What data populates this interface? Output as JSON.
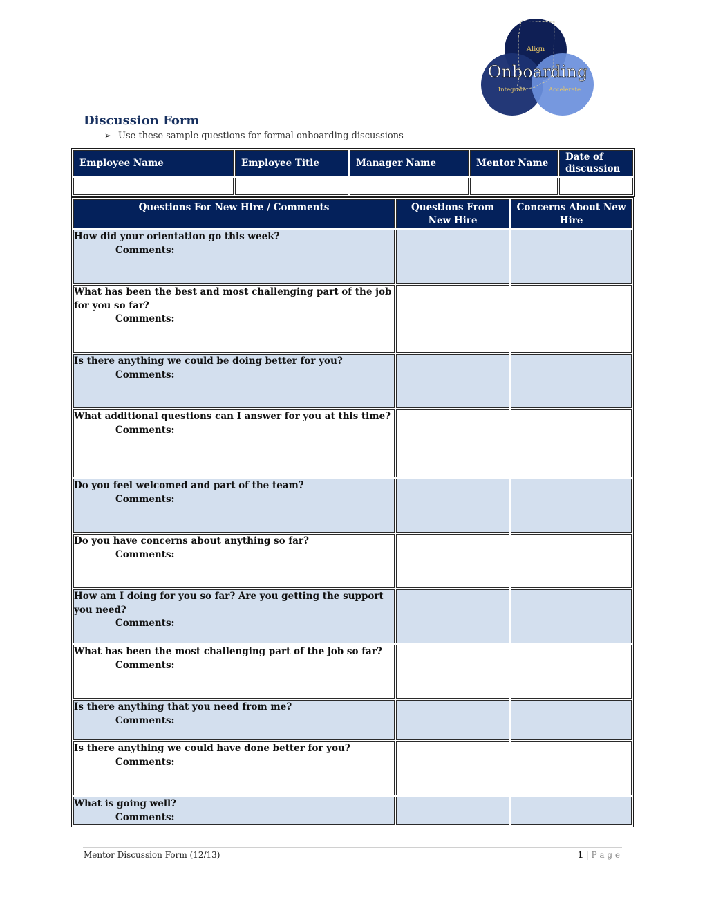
{
  "logo": {
    "brand_text": "Onboarding",
    "circle_labels": [
      "Align",
      "Integrate",
      "Accelerate"
    ],
    "colors": {
      "align": "#0f1f55",
      "integrate": "#1c3273",
      "accelerate": "#6a8fdc",
      "label_gold": "#e8c766"
    }
  },
  "header": {
    "title": "Discussion Form",
    "bullet_icon": "arrowhead-bullet",
    "subtitle": "Use these sample questions for formal onboarding discussions"
  },
  "info_table": {
    "columns": [
      "Employee Name",
      "Employee Title",
      "Manager Name",
      "Mentor Name",
      "Date of discussion"
    ],
    "values": [
      "",
      "",
      "",
      "",
      ""
    ]
  },
  "questions_table": {
    "columns": [
      "Questions For New Hire / Comments",
      "Questions From New Hire",
      "Concerns About New Hire"
    ],
    "comments_label": "Comments:",
    "rows": [
      {
        "question": "How did your orientation go this week?",
        "questions_from": "",
        "concerns": ""
      },
      {
        "question": "What has been the best and most challenging part of the job for you so far?",
        "questions_from": "",
        "concerns": ""
      },
      {
        "question": "Is there anything we could be doing better for you?",
        "questions_from": "",
        "concerns": ""
      },
      {
        "question": "What additional questions can I answer for you at this time?",
        "questions_from": "",
        "concerns": ""
      },
      {
        "question": "Do you feel welcomed and part of the team?",
        "questions_from": "",
        "concerns": ""
      },
      {
        "question": "Do you have concerns about anything so far?",
        "questions_from": "",
        "concerns": ""
      },
      {
        "question": "How am I doing for you so far? Are you getting the support you need?",
        "questions_from": "",
        "concerns": ""
      },
      {
        "question": "What has been the most challenging part of the job so far?",
        "questions_from": "",
        "concerns": ""
      },
      {
        "question": "Is there anything that you need from me?",
        "questions_from": "",
        "concerns": ""
      },
      {
        "question": "Is there anything we could have done better for you?",
        "questions_from": "",
        "concerns": ""
      },
      {
        "question": "What is going well?",
        "questions_from": "",
        "concerns": ""
      }
    ]
  },
  "colors": {
    "header_fill": "#04215b",
    "row_shade": "#d3dfee",
    "title": "#17305f"
  },
  "footer": {
    "left": "Mentor Discussion Form (12/13)",
    "page_number": "1",
    "separator": "|",
    "page_label": "P a g e"
  }
}
